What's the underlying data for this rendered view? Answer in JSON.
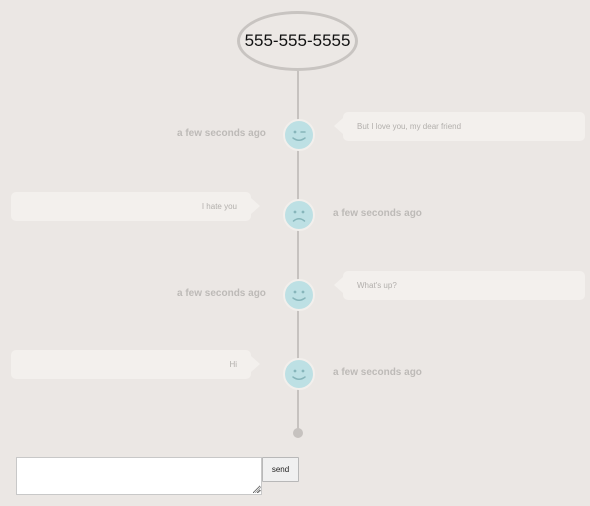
{
  "header": {
    "phone_number": "555-555-5555"
  },
  "messages": [
    {
      "side": "right",
      "text": "But I love you, my dear friend",
      "timestamp": "a few seconds ago",
      "mood": "wink"
    },
    {
      "side": "left",
      "text": "I hate you",
      "timestamp": "a few seconds ago",
      "mood": "sad"
    },
    {
      "side": "right",
      "text": "What's up?",
      "timestamp": "a few seconds ago",
      "mood": "happy"
    },
    {
      "side": "left",
      "text": "Hi",
      "timestamp": "a few seconds ago",
      "mood": "happy"
    }
  ],
  "composer": {
    "send_label": "send",
    "input_value": ""
  },
  "colors": {
    "background": "#ebe7e4",
    "avatar": "#bde0e4",
    "bubble": "#f3f0ed",
    "timeline": "#c6c2bf"
  }
}
